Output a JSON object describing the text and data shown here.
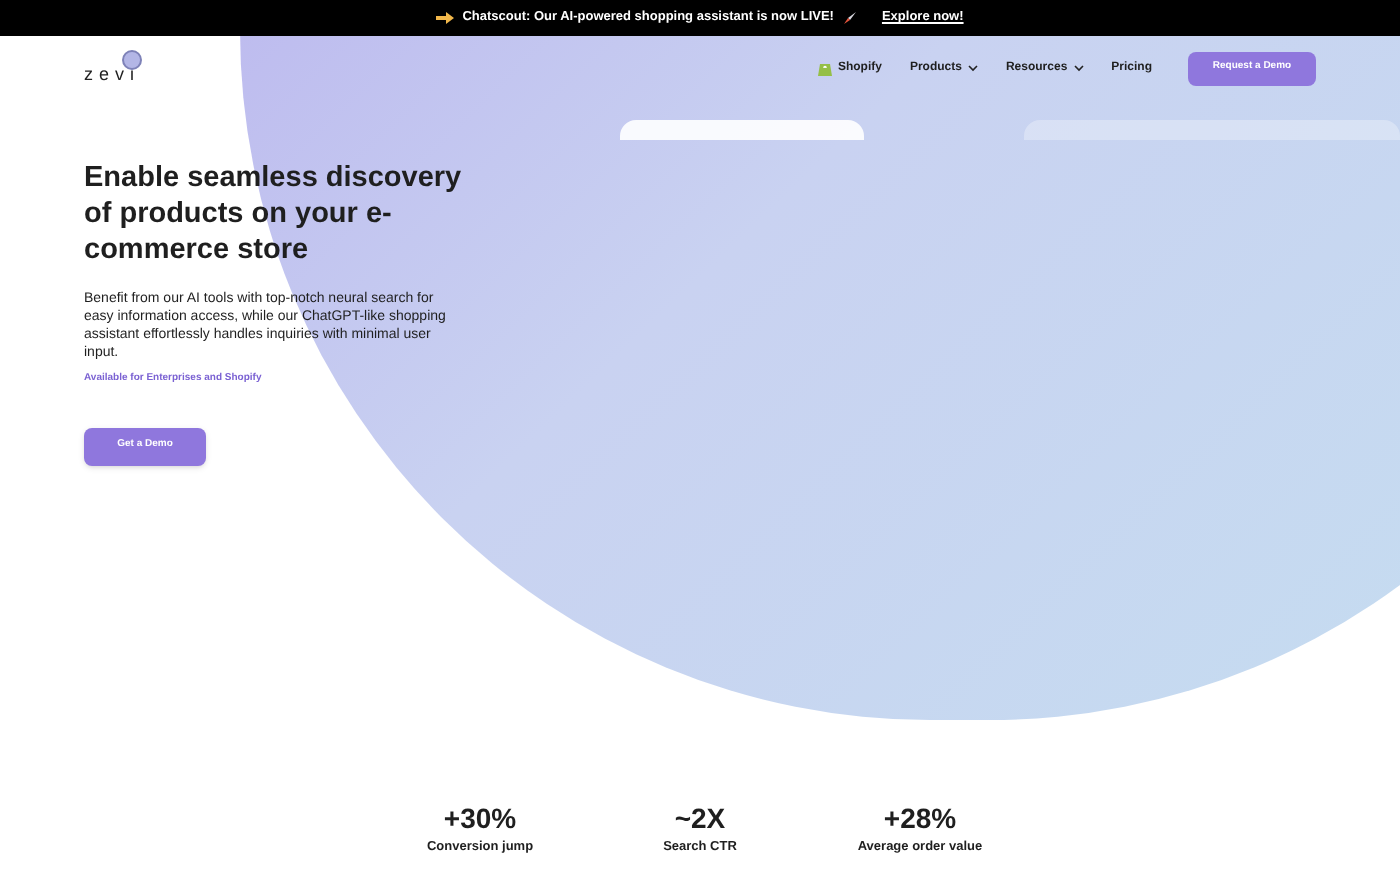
{
  "announcement": {
    "text": "Chatscout: Our AI-powered shopping assistant is now LIVE!",
    "link": "Explore now!"
  },
  "nav": {
    "logo": "zevi",
    "items": [
      {
        "label": "Shopify",
        "kind": "brand"
      },
      {
        "label": "Products",
        "kind": "dropdown"
      },
      {
        "label": "Resources",
        "kind": "dropdown"
      },
      {
        "label": "Pricing",
        "kind": "link"
      }
    ],
    "cta": "Request a Demo"
  },
  "hero": {
    "title": "Enable seamless discovery of products on your e-commerce store",
    "description": "Benefit from our AI tools with top-notch neural search for easy information access, while our ChatGPT-like shopping assistant effortlessly handles inquiries with minimal user input.",
    "availability": "Available for Enterprises and Shopify",
    "button": "Get a Demo"
  },
  "stats": [
    {
      "value": "+30%",
      "label": "Conversion jump"
    },
    {
      "value": "~2X",
      "label": "Search CTR"
    },
    {
      "value": "+28%",
      "label": "Average order value"
    }
  ]
}
